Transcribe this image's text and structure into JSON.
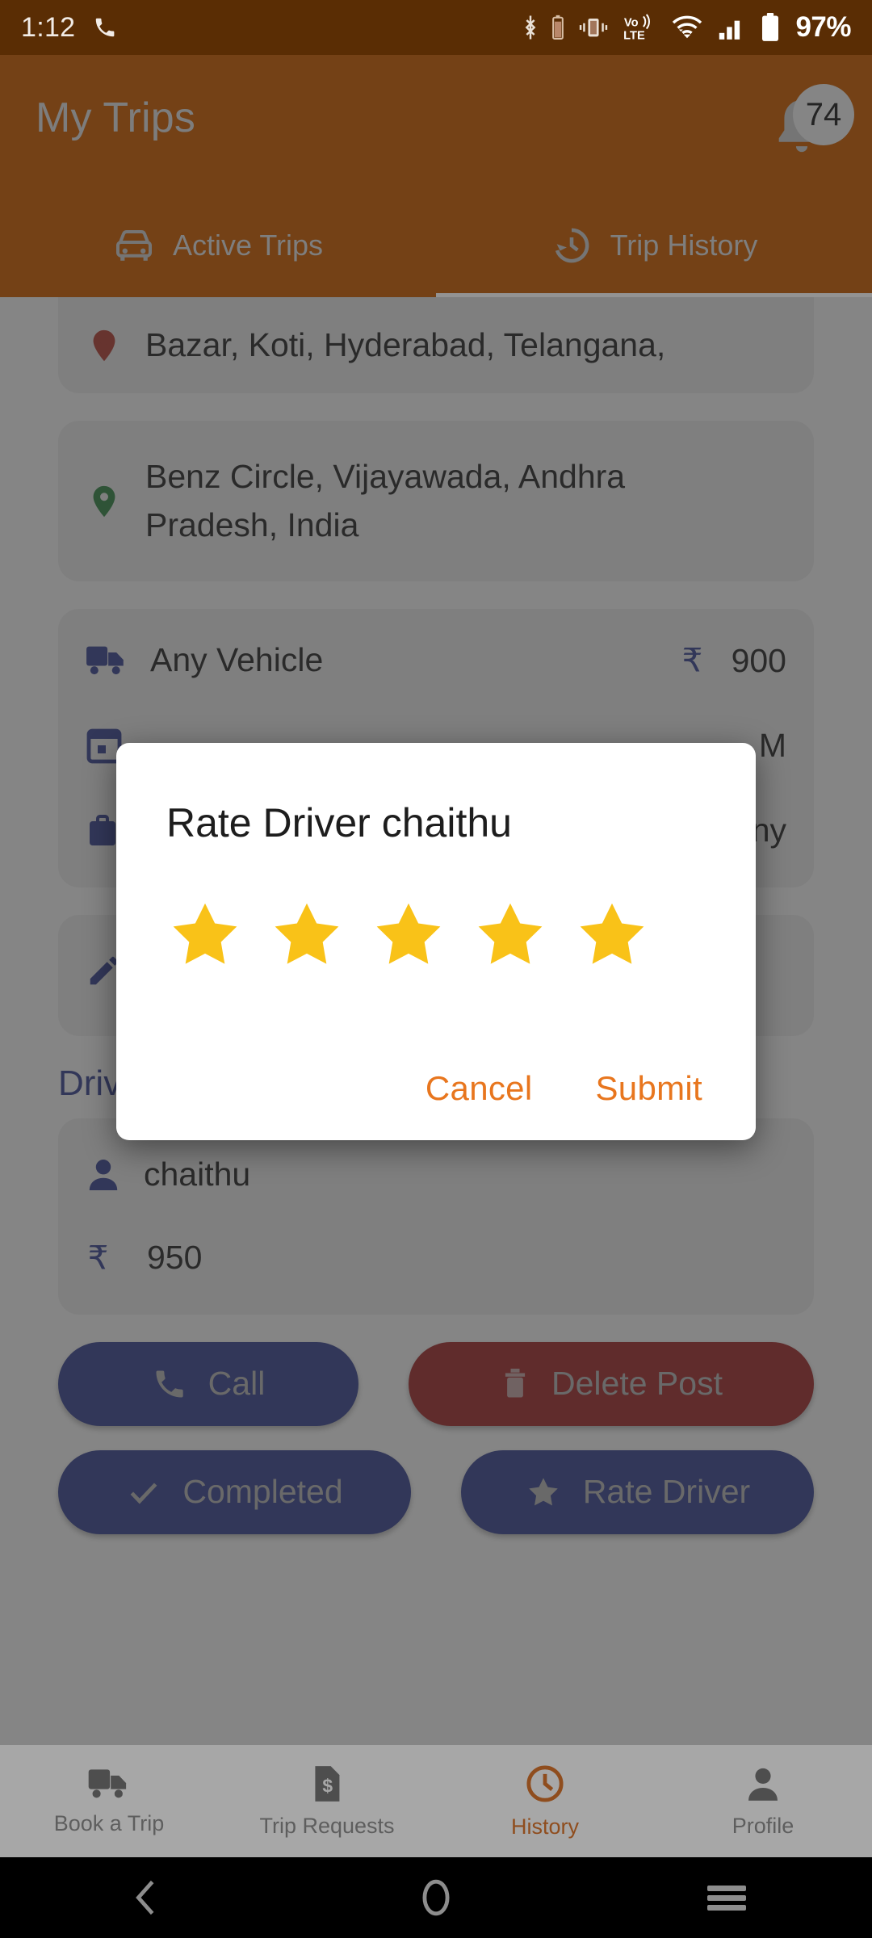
{
  "status_bar": {
    "time": "1:12",
    "call_icon": "phone-icon",
    "battery_percent": "97%",
    "icons": [
      "bluetooth-icon",
      "vibrate-icon",
      "volte-icon",
      "wifi-icon",
      "signal-icon",
      "battery-icon"
    ]
  },
  "header": {
    "title": "My Trips",
    "notification_badge": "74",
    "bell_icon": "bell-icon",
    "tabs": [
      {
        "label": "Active Trips",
        "icon": "car-icon",
        "active": false
      },
      {
        "label": "Trip History",
        "icon": "history-icon",
        "active": true
      }
    ]
  },
  "trip": {
    "pickup": {
      "icon": "pickup-pin-icon",
      "text": "Bazar, Koti, Hyderabad, Telangana,"
    },
    "drop": {
      "icon": "drop-pin-icon",
      "text": "Benz Circle, Vijayawada, Andhra Pradesh, India"
    },
    "vehicle": {
      "icon": "truck-icon",
      "label": "Any Vehicle",
      "currency_icon": "rupee-icon",
      "price": "900"
    },
    "date": {
      "icon": "calendar-icon",
      "text": "M"
    },
    "goods": {
      "icon": "briefcase-icon",
      "text": "ny"
    },
    "note": {
      "icon": "edit-icon"
    }
  },
  "driver_info": {
    "section_title": "Driver Info",
    "name_icon": "person-icon",
    "name": "chaithu",
    "price_icon": "rupee-icon",
    "price": "950"
  },
  "actions": {
    "call": {
      "label": "Call",
      "icon": "phone-icon",
      "color": "#27348b"
    },
    "delete": {
      "label": "Delete Post",
      "icon": "trash-icon",
      "color": "#9e1616"
    },
    "completed": {
      "label": "Completed",
      "icon": "check-icon",
      "color": "#27348b"
    },
    "rate": {
      "label": "Rate Driver",
      "icon": "star-icon",
      "color": "#27348b"
    }
  },
  "dialog": {
    "title": "Rate Driver chaithu",
    "rating": 5,
    "max_rating": 5,
    "star_color": "#f9c218",
    "cancel_label": "Cancel",
    "submit_label": "Submit",
    "action_color": "#e8761e"
  },
  "bottom_nav": [
    {
      "label": "Book a Trip",
      "icon": "truck-icon",
      "active": false
    },
    {
      "label": "Trip Requests",
      "icon": "invoice-icon",
      "active": false
    },
    {
      "label": "History",
      "icon": "clock-icon",
      "active": true
    },
    {
      "label": "Profile",
      "icon": "person-icon",
      "active": false
    }
  ],
  "system_nav": {
    "back": "back-chevron-icon",
    "home": "home-circle-icon",
    "recents": "recents-menu-icon"
  },
  "colors": {
    "header_bg": "#8d4406",
    "status_bar_bg": "#5a2d04",
    "accent_orange": "#c95b0c",
    "navy": "#27348b",
    "red": "#9e1616"
  }
}
